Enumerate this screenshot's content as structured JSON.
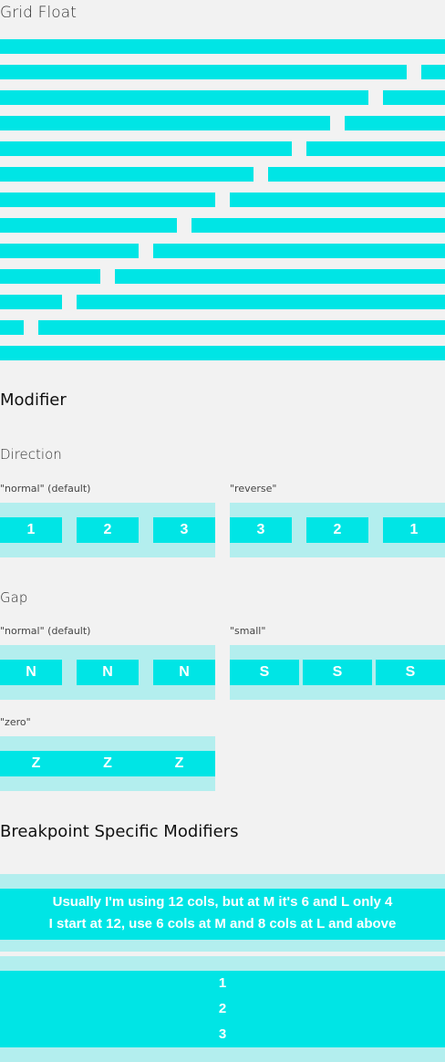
{
  "sections": {
    "grid_float_title": "Grid Float",
    "modifier_title": "Modifier",
    "breakpoint_title": "Breakpoint Specific Modifiers"
  },
  "direction": {
    "title": "Direction",
    "normal_label": "\"normal\" (default)",
    "reverse_label": "\"reverse\"",
    "normal_items": [
      "1",
      "2",
      "3"
    ],
    "reverse_items": [
      "3",
      "2",
      "1"
    ]
  },
  "gap": {
    "title": "Gap",
    "normal_label": "\"normal\" (default)",
    "small_label": "\"small\"",
    "zero_label": "\"zero\"",
    "normal_items": [
      "N",
      "N",
      "N"
    ],
    "small_items": [
      "S",
      "S",
      "S"
    ],
    "zero_items": [
      "Z",
      "Z",
      "Z"
    ]
  },
  "breakpoint": {
    "line1": "Usually I'm using 12 cols, but at M it's 6 and L only 4",
    "line2": "I start at 12, use 6 cols at M and 8 cols at L and above",
    "items": [
      "1",
      "2",
      "3"
    ]
  },
  "colors": {
    "accent": "#00e5e5",
    "row_bg": "#b3eeee",
    "page_bg": "#f2f2f2"
  }
}
